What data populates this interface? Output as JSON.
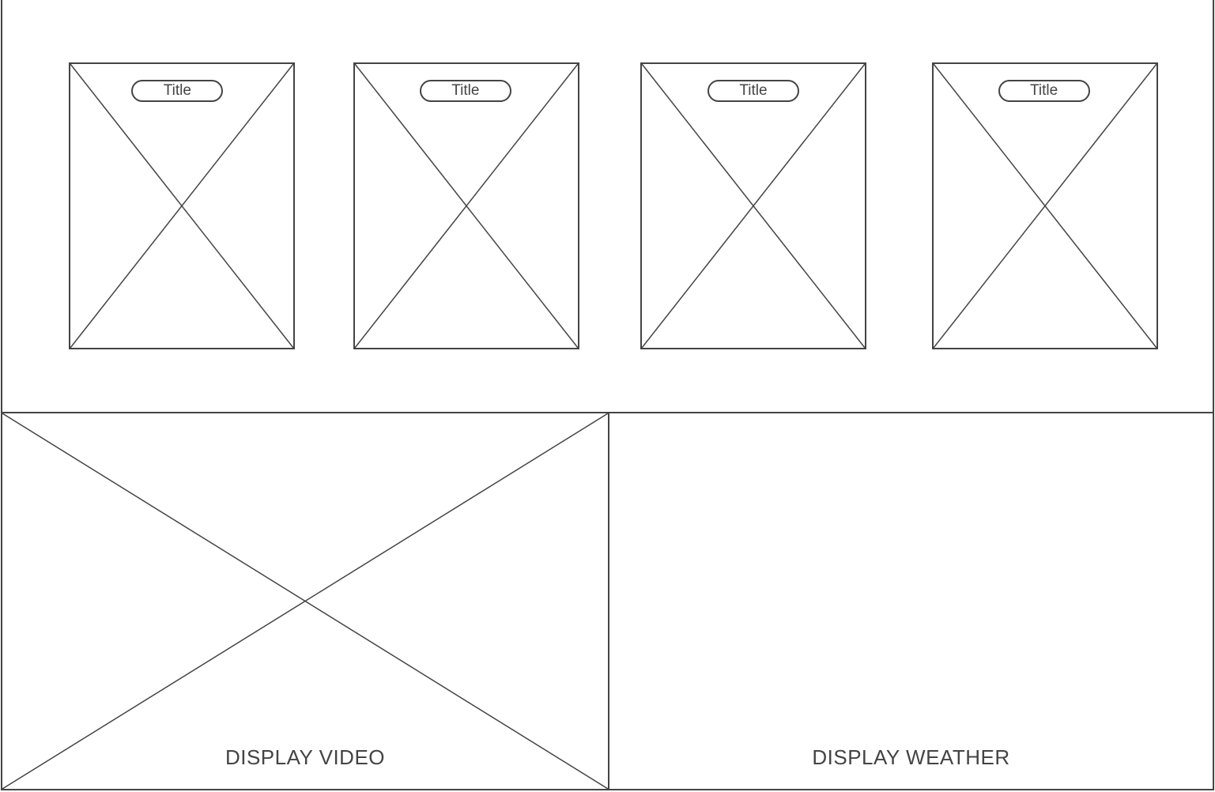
{
  "cards": [
    {
      "title": "Title"
    },
    {
      "title": "Title"
    },
    {
      "title": "Title"
    },
    {
      "title": "Title"
    }
  ],
  "video_panel": {
    "label": "DISPLAY VIDEO"
  },
  "weather_panel": {
    "label": "DISPLAY WEATHER"
  },
  "colors": {
    "stroke": "#444444",
    "background": "#ffffff"
  }
}
